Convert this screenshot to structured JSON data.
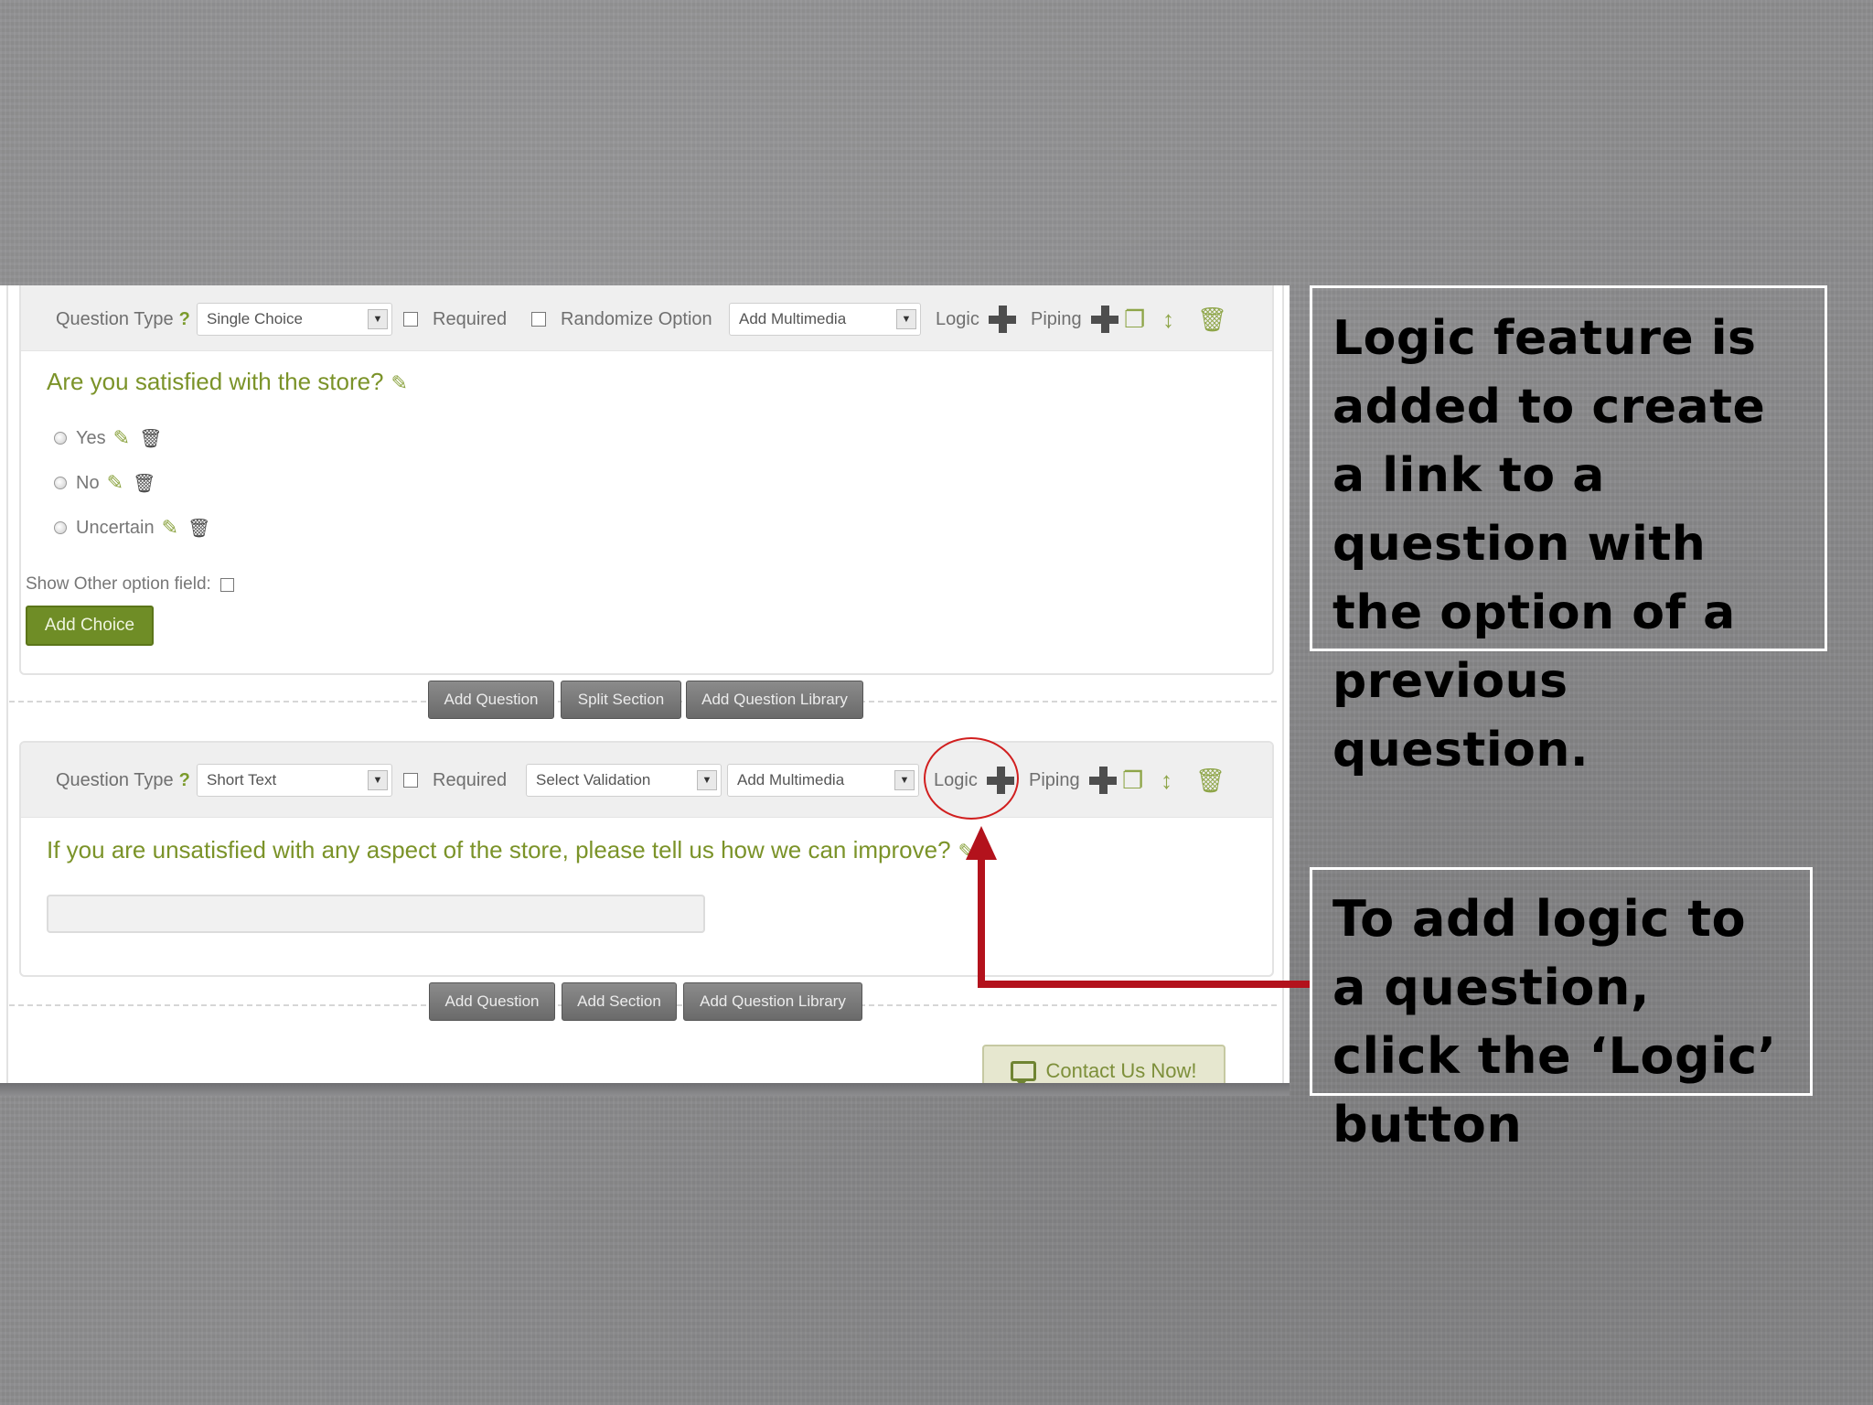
{
  "question1": {
    "toolbar": {
      "question_type_label": "Question Type",
      "help_mark": "?",
      "type_value": "Single Choice",
      "required_label": "Required",
      "randomize_label": "Randomize Option",
      "multimedia_value": "Add Multimedia",
      "logic_label": "Logic",
      "piping_label": "Piping"
    },
    "text": "Are you satisfied with the store?",
    "choices": [
      "Yes",
      "No",
      "Uncertain"
    ],
    "other_field_label": "Show Other option field:",
    "add_choice_label": "Add Choice"
  },
  "actions1": {
    "add_question": "Add Question",
    "split_section": "Split Section",
    "add_library": "Add Question Library"
  },
  "question2": {
    "toolbar": {
      "question_type_label": "Question Type",
      "help_mark": "?",
      "type_value": "Short Text",
      "required_label": "Required",
      "validation_value": "Select Validation",
      "multimedia_value": "Add Multimedia",
      "logic_label": "Logic",
      "piping_label": "Piping"
    },
    "text": "If you are unsatisfied with any aspect of the store, please tell us how we can improve?"
  },
  "actions2": {
    "add_question": "Add Question",
    "add_section": "Add Section",
    "add_library": "Add Question Library"
  },
  "contact": {
    "label": "Contact Us Now!"
  },
  "callouts": {
    "top": "Logic feature is added to create a link to a question with the option of a previous question.",
    "bottom": "To add logic to a question, click the ‘Logic’ button"
  },
  "icons": {
    "pencil": "✎",
    "trash": "🗑",
    "copy": "❐",
    "move": "↕",
    "dropdown": "▼"
  },
  "colors": {
    "accent_green": "#7b9329",
    "highlight_red": "#d11f1f",
    "arrow_red": "#b3121c"
  }
}
